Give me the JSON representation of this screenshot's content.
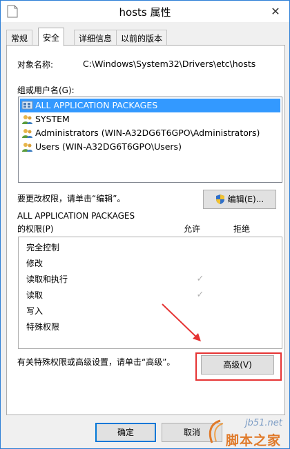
{
  "window": {
    "title": "hosts 属性",
    "close_glyph": "✕"
  },
  "tabs": [
    {
      "label": "常规",
      "active": false
    },
    {
      "label": "安全",
      "active": true
    },
    {
      "label": "详细信息",
      "active": false
    },
    {
      "label": "以前的版本",
      "active": false
    }
  ],
  "security": {
    "object_name_label": "对象名称:",
    "object_name_value": "C:\\Windows\\System32\\Drivers\\etc\\hosts",
    "group_label": "组或用户名(G):",
    "users": [
      {
        "name": "ALL APPLICATION PACKAGES",
        "icon": "packages-icon",
        "selected": true
      },
      {
        "name": "SYSTEM",
        "icon": "users-group-icon",
        "selected": false
      },
      {
        "name": "Administrators (WIN-A32DG6T6GPO\\Administrators)",
        "icon": "users-group-icon",
        "selected": false
      },
      {
        "name": "Users (WIN-A32DG6T6GPO\\Users)",
        "icon": "users-group-icon",
        "selected": false
      }
    ],
    "edit_hint": "要更改权限，请单击“编辑”。",
    "edit_button": "编辑(E)...",
    "perm_title_line1": "ALL APPLICATION PACKAGES",
    "perm_title_line2": "的权限(P)",
    "allow_header": "允许",
    "deny_header": "拒绝",
    "permissions": [
      {
        "name": "完全控制",
        "allow": false,
        "deny": false
      },
      {
        "name": "修改",
        "allow": false,
        "deny": false
      },
      {
        "name": "读取和执行",
        "allow": true,
        "deny": false
      },
      {
        "name": "读取",
        "allow": true,
        "deny": false
      },
      {
        "name": "写入",
        "allow": false,
        "deny": false
      },
      {
        "name": "特殊权限",
        "allow": false,
        "deny": false
      }
    ],
    "check_glyph": "✓",
    "advanced_hint": "有关特殊权限或高级设置，请单击“高级”。",
    "advanced_button": "高级(V)"
  },
  "footer": {
    "ok_button": "确定",
    "cancel_button": "取消"
  },
  "watermark": {
    "site": "jb51.net",
    "brand": "脚本之家"
  },
  "colors": {
    "accent": "#2b7ed6",
    "selection": "#3399ff",
    "annotation_red": "#e53333"
  }
}
